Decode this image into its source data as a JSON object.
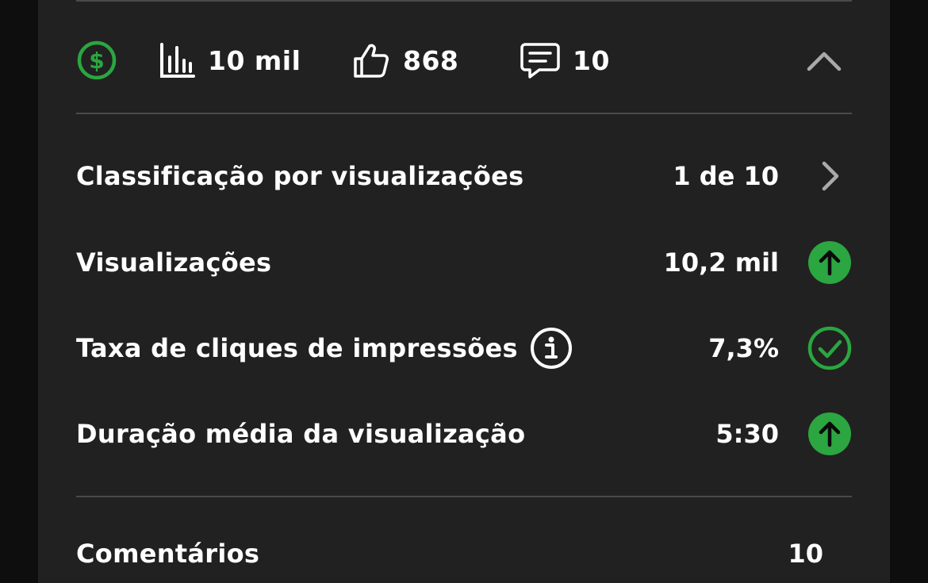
{
  "stats": {
    "views": "10 mil",
    "likes": "868",
    "comments": "10"
  },
  "metrics": [
    {
      "label": "Classificação por visualizações",
      "value": "1 de 10",
      "indicator": "chevron-right-icon"
    },
    {
      "label": "Visualizações",
      "value": "10,2 mil",
      "indicator": "arrow-up-icon"
    },
    {
      "label": "Taxa de cliques de impressões",
      "value": "7,3%",
      "indicator": "check-circle-icon"
    },
    {
      "label": "Duração média da visualização",
      "value": "5:30",
      "indicator": "arrow-up-icon"
    }
  ],
  "comments_section": {
    "label": "Comentários",
    "value": "10"
  },
  "colors": {
    "background": "#212121",
    "accent_green": "#2ba640",
    "text": "#ffffff",
    "muted": "#aaaaaa",
    "divider": "#4a4a4a"
  },
  "icons": [
    "monetization-icon",
    "bar-chart-icon",
    "thumbs-up-icon",
    "comment-icon",
    "chevron-up-icon",
    "info-icon"
  ]
}
